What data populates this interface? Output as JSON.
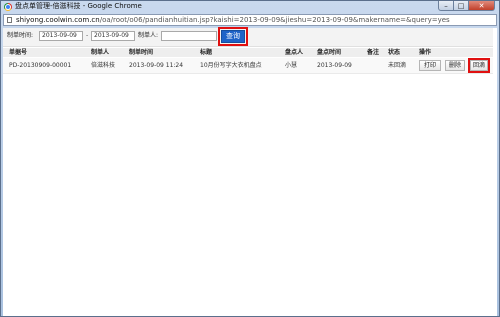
{
  "window": {
    "title": "盘点单管理-倍滋科技 - Google Chrome",
    "controls": {
      "minimize": "–",
      "maximize": "□",
      "close": "✕"
    }
  },
  "address_bar": {
    "domain": "shiyong.coolwin.com.cn",
    "path": "/oa/root/o06/pandianhuitian.jsp?kaishi=2013-09-09&jieshu=2013-09-09&makername=&query=yes"
  },
  "filters": {
    "time_label": "制单时间:",
    "date_from": "2013-09-09",
    "separator": "-",
    "date_to": "2013-09-09",
    "maker_label": "制单人:",
    "maker_value": "",
    "search_label": "查询"
  },
  "table": {
    "columns": [
      "单据号",
      "制单人",
      "制单时间",
      "标题",
      "盘点人",
      "盘点时间",
      "备注",
      "状态",
      "操作"
    ],
    "rows": [
      {
        "doc_no": "PD-20130909-00001",
        "maker": "倍滋科技",
        "make_time": "2013-09-09 11:24",
        "title": "10月份写字大衣机盘点",
        "counter": "小慧",
        "count_time": "2013-09-09",
        "remark": "",
        "status": "未回滴",
        "actions": {
          "print": "打印",
          "delete": "删除",
          "rollback": "回滴"
        }
      }
    ]
  },
  "colors": {
    "search_button": "#1e63c8",
    "highlight_box": "#e01010",
    "title_bar": "#c9d9ee"
  }
}
